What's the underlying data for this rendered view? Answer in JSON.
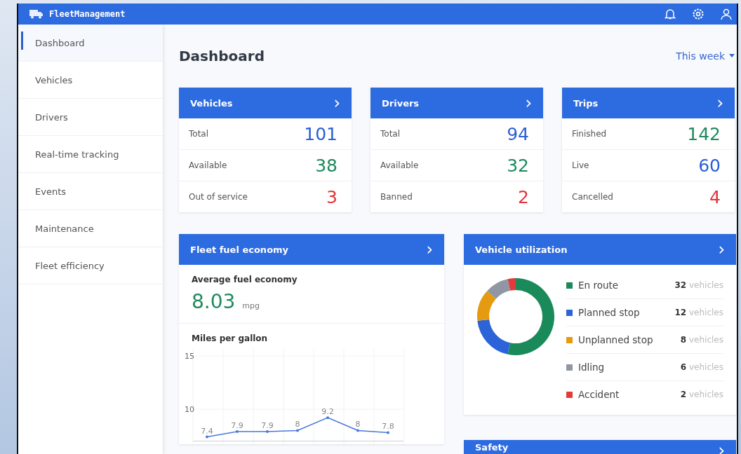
{
  "app": {
    "title": "FleetManagement"
  },
  "sidebar": {
    "items": [
      {
        "label": "Dashboard",
        "selected": true
      },
      {
        "label": "Vehicles",
        "selected": false
      },
      {
        "label": "Drivers",
        "selected": false
      },
      {
        "label": "Real-time tracking",
        "selected": false
      },
      {
        "label": "Events",
        "selected": false
      },
      {
        "label": "Maintenance",
        "selected": false
      },
      {
        "label": "Fleet efficiency",
        "selected": false
      }
    ]
  },
  "page": {
    "title": "Dashboard",
    "period": "This week"
  },
  "stat_cards": [
    {
      "title": "Vehicles",
      "arrow": "›",
      "rows": [
        {
          "label": "Total",
          "value": "101",
          "color": "#2a5fd6"
        },
        {
          "label": "Available",
          "value": "38",
          "color": "#1e8a5e"
        },
        {
          "label": "Out of service",
          "value": "3",
          "color": "#e0353a"
        }
      ]
    },
    {
      "title": "Drivers",
      "arrow": "›",
      "rows": [
        {
          "label": "Total",
          "value": "94",
          "color": "#2a5fd6"
        },
        {
          "label": "Available",
          "value": "32",
          "color": "#1e8a5e"
        },
        {
          "label": "Banned",
          "value": "2",
          "color": "#e0353a"
        }
      ]
    },
    {
      "title": "Trips",
      "arrow": "›",
      "rows": [
        {
          "label": "Finished",
          "value": "142",
          "color": "#1e8a5e"
        },
        {
          "label": "Live",
          "value": "60",
          "color": "#2a5fd6"
        },
        {
          "label": "Cancelled",
          "value": "4",
          "color": "#e0353a"
        }
      ]
    }
  ],
  "fuel": {
    "title": "Fleet fuel economy",
    "arrow": "›",
    "average_label": "Average fuel economy",
    "average": "8.03",
    "unit": "mpg",
    "chart_data": {
      "type": "line",
      "title": "Miles per gallon",
      "values": [
        7.4,
        7.9,
        7.9,
        8,
        9.2,
        8,
        7.8
      ],
      "ylim": [
        7,
        15
      ],
      "yticks": [
        10,
        15
      ],
      "data_labels": true
    }
  },
  "utilization": {
    "title": "Vehicle utilization",
    "arrow": "›",
    "items": [
      {
        "label": "En route",
        "count": "32",
        "unit": "vehicles",
        "color": "#1a8a5a"
      },
      {
        "label": "Planned stop",
        "count": "12",
        "unit": "vehicles",
        "color": "#2d63d8"
      },
      {
        "label": "Unplanned stop",
        "count": "8",
        "unit": "vehicles",
        "color": "#e69a10"
      },
      {
        "label": "Idling",
        "count": "6",
        "unit": "vehicles",
        "color": "#9097a3"
      },
      {
        "label": "Accident",
        "count": "2",
        "unit": "vehicles",
        "color": "#e23b3b"
      }
    ]
  },
  "safety": {
    "title": "Safety",
    "arrow": "›"
  }
}
